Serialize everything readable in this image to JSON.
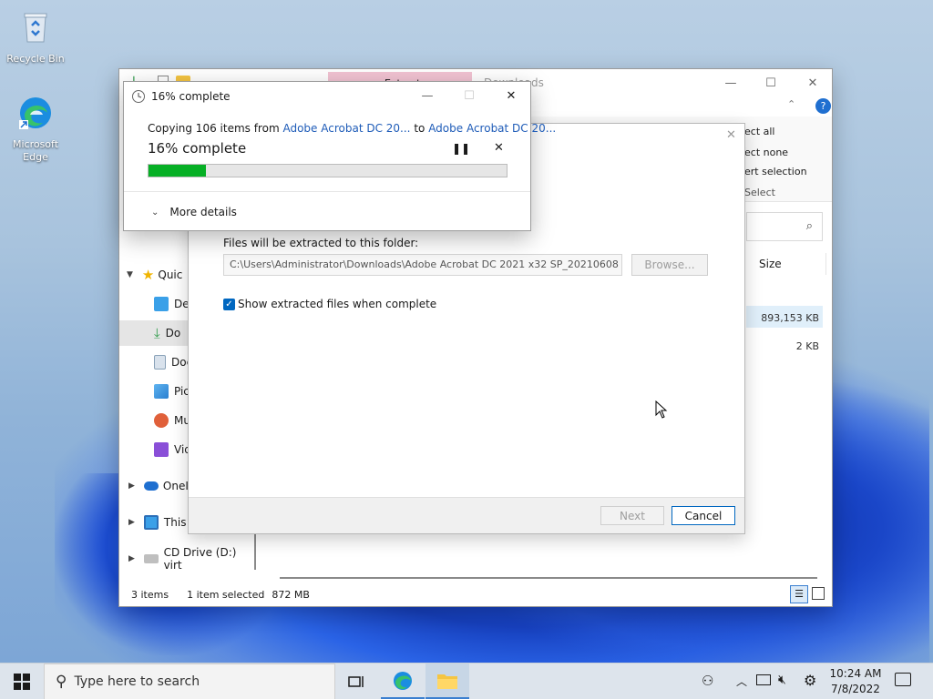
{
  "desktop": {
    "icons": [
      {
        "label": "Recycle Bin"
      },
      {
        "label_line1": "Microsoft",
        "label_line2": "Edge"
      }
    ]
  },
  "explorer": {
    "title": "Downloads",
    "ribbon_tab": "Extract",
    "ribbon": {
      "select_all": "ect all",
      "select_none": "ect none",
      "invert_selection": "ert selection",
      "select_group": "Select"
    },
    "column_size": "Size",
    "sizes": [
      "893,153 KB",
      "2 KB"
    ],
    "nav": {
      "quick_access": "Quic",
      "desktop": "Des",
      "downloads": "Do",
      "documents": "Doc",
      "pictures": "Pic",
      "music": "Mu",
      "videos": "Vid",
      "onedrive": "OneI",
      "this_pc": "This",
      "cd_drive": "CD Drive (D:) virt"
    },
    "status": {
      "items": "3 items",
      "selected": "1 item selected",
      "size": "872 MB"
    }
  },
  "wizard": {
    "folder_label": "Files will be extracted to this folder:",
    "path": "C:\\Users\\Administrator\\Downloads\\Adobe Acrobat DC 2021 x32 SP_20210608",
    "browse": "Browse...",
    "checkbox_label": "Show extracted files when complete",
    "next": "Next",
    "cancel": "Cancel"
  },
  "copy_dialog": {
    "title": "16% complete",
    "copy_prefix": "Copying 106 items from",
    "source": "Adobe Acrobat DC 20...",
    "to": "to",
    "destination": "Adobe Acrobat DC 20...",
    "percent_text": "16% complete",
    "progress": 0.16,
    "more_details": "More details"
  },
  "taskbar": {
    "search_placeholder": "Type here to search",
    "time": "10:24 AM",
    "date": "7/8/2022"
  },
  "colors": {
    "accent": "#0067c0",
    "progress": "#06b025",
    "link": "#1f5cb8",
    "extract_tab": "#f2c3d2"
  }
}
